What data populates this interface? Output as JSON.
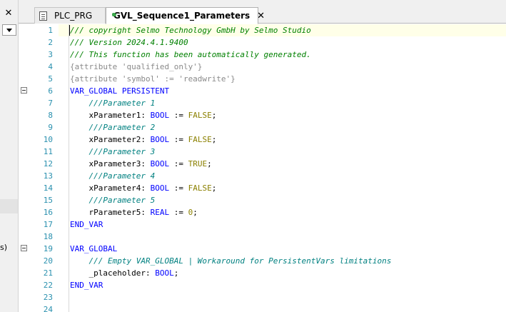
{
  "left_panel": {
    "close_glyph": "✕",
    "fragment_text": "s)"
  },
  "tabs": [
    {
      "label": "PLC_PRG",
      "icon": "document-icon",
      "active": false
    },
    {
      "label": "GVL_Sequence1_Parameters",
      "icon": "globe-icon",
      "active": true,
      "close_glyph": "✕"
    }
  ],
  "colors": {
    "line_number": "#2b91af",
    "keyword": "#0000ff",
    "comment": "#008000",
    "doc_comment": "#008080",
    "literal": "#8b8000"
  },
  "editor": {
    "line_numbers": [
      "1",
      "2",
      "3",
      "4",
      "5",
      "6",
      "7",
      "8",
      "9",
      "10",
      "11",
      "12",
      "13",
      "14",
      "15",
      "16",
      "17",
      "18",
      "19",
      "20",
      "21",
      "22",
      "23",
      "24"
    ],
    "lines": [
      {
        "segments": [
          [
            "/// copyright Selmo Technology GmbH by Selmo Studio",
            "com"
          ]
        ]
      },
      {
        "segments": [
          [
            "/// Version 2024.4.1.9400",
            "com"
          ]
        ]
      },
      {
        "segments": [
          [
            "/// This function has been automatically generated.",
            "com"
          ]
        ]
      },
      {
        "segments": [
          [
            "{attribute 'qualified_only'}",
            "attr"
          ]
        ]
      },
      {
        "segments": [
          [
            "{attribute 'symbol' := 'readwrite'}",
            "attr"
          ]
        ]
      },
      {
        "segments": [
          [
            "VAR_GLOBAL PERSISTENT",
            "kw"
          ]
        ],
        "fold": true
      },
      {
        "segments": [
          [
            "    ///Parameter 1",
            "doc"
          ]
        ]
      },
      {
        "segments": [
          [
            "    xParameter1: ",
            "id"
          ],
          [
            "BOOL",
            "ty"
          ],
          [
            " := ",
            "id"
          ],
          [
            "FALSE",
            "lit"
          ],
          [
            ";",
            "id"
          ]
        ]
      },
      {
        "segments": [
          [
            "    ///Parameter 2",
            "doc"
          ]
        ]
      },
      {
        "segments": [
          [
            "    xParameter2: ",
            "id"
          ],
          [
            "BOOL",
            "ty"
          ],
          [
            " := ",
            "id"
          ],
          [
            "FALSE",
            "lit"
          ],
          [
            ";",
            "id"
          ]
        ]
      },
      {
        "segments": [
          [
            "    ///Parameter 3",
            "doc"
          ]
        ]
      },
      {
        "segments": [
          [
            "    xParameter3: ",
            "id"
          ],
          [
            "BOOL",
            "ty"
          ],
          [
            " := ",
            "id"
          ],
          [
            "TRUE",
            "lit"
          ],
          [
            ";",
            "id"
          ]
        ]
      },
      {
        "segments": [
          [
            "    ///Parameter 4",
            "doc"
          ]
        ]
      },
      {
        "segments": [
          [
            "    xParameter4: ",
            "id"
          ],
          [
            "BOOL",
            "ty"
          ],
          [
            " := ",
            "id"
          ],
          [
            "FALSE",
            "lit"
          ],
          [
            ";",
            "id"
          ]
        ]
      },
      {
        "segments": [
          [
            "    ///Parameter 5",
            "doc"
          ]
        ]
      },
      {
        "segments": [
          [
            "    rParameter5: ",
            "id"
          ],
          [
            "REAL",
            "ty"
          ],
          [
            " := ",
            "id"
          ],
          [
            "0",
            "num"
          ],
          [
            ";",
            "id"
          ]
        ]
      },
      {
        "segments": [
          [
            "END_VAR",
            "kw"
          ]
        ]
      },
      {
        "segments": []
      },
      {
        "segments": [
          [
            "VAR_GLOBAL",
            "kw"
          ]
        ],
        "fold": true
      },
      {
        "segments": [
          [
            "    /// Empty VAR_GLOBAL | Workaround for PersistentVars limitations",
            "doc"
          ]
        ]
      },
      {
        "segments": [
          [
            "    _placeholder: ",
            "id"
          ],
          [
            "BOOL",
            "ty"
          ],
          [
            ";",
            "id"
          ]
        ]
      },
      {
        "segments": [
          [
            "END_VAR",
            "kw"
          ]
        ]
      },
      {
        "segments": []
      },
      {
        "segments": []
      }
    ]
  }
}
